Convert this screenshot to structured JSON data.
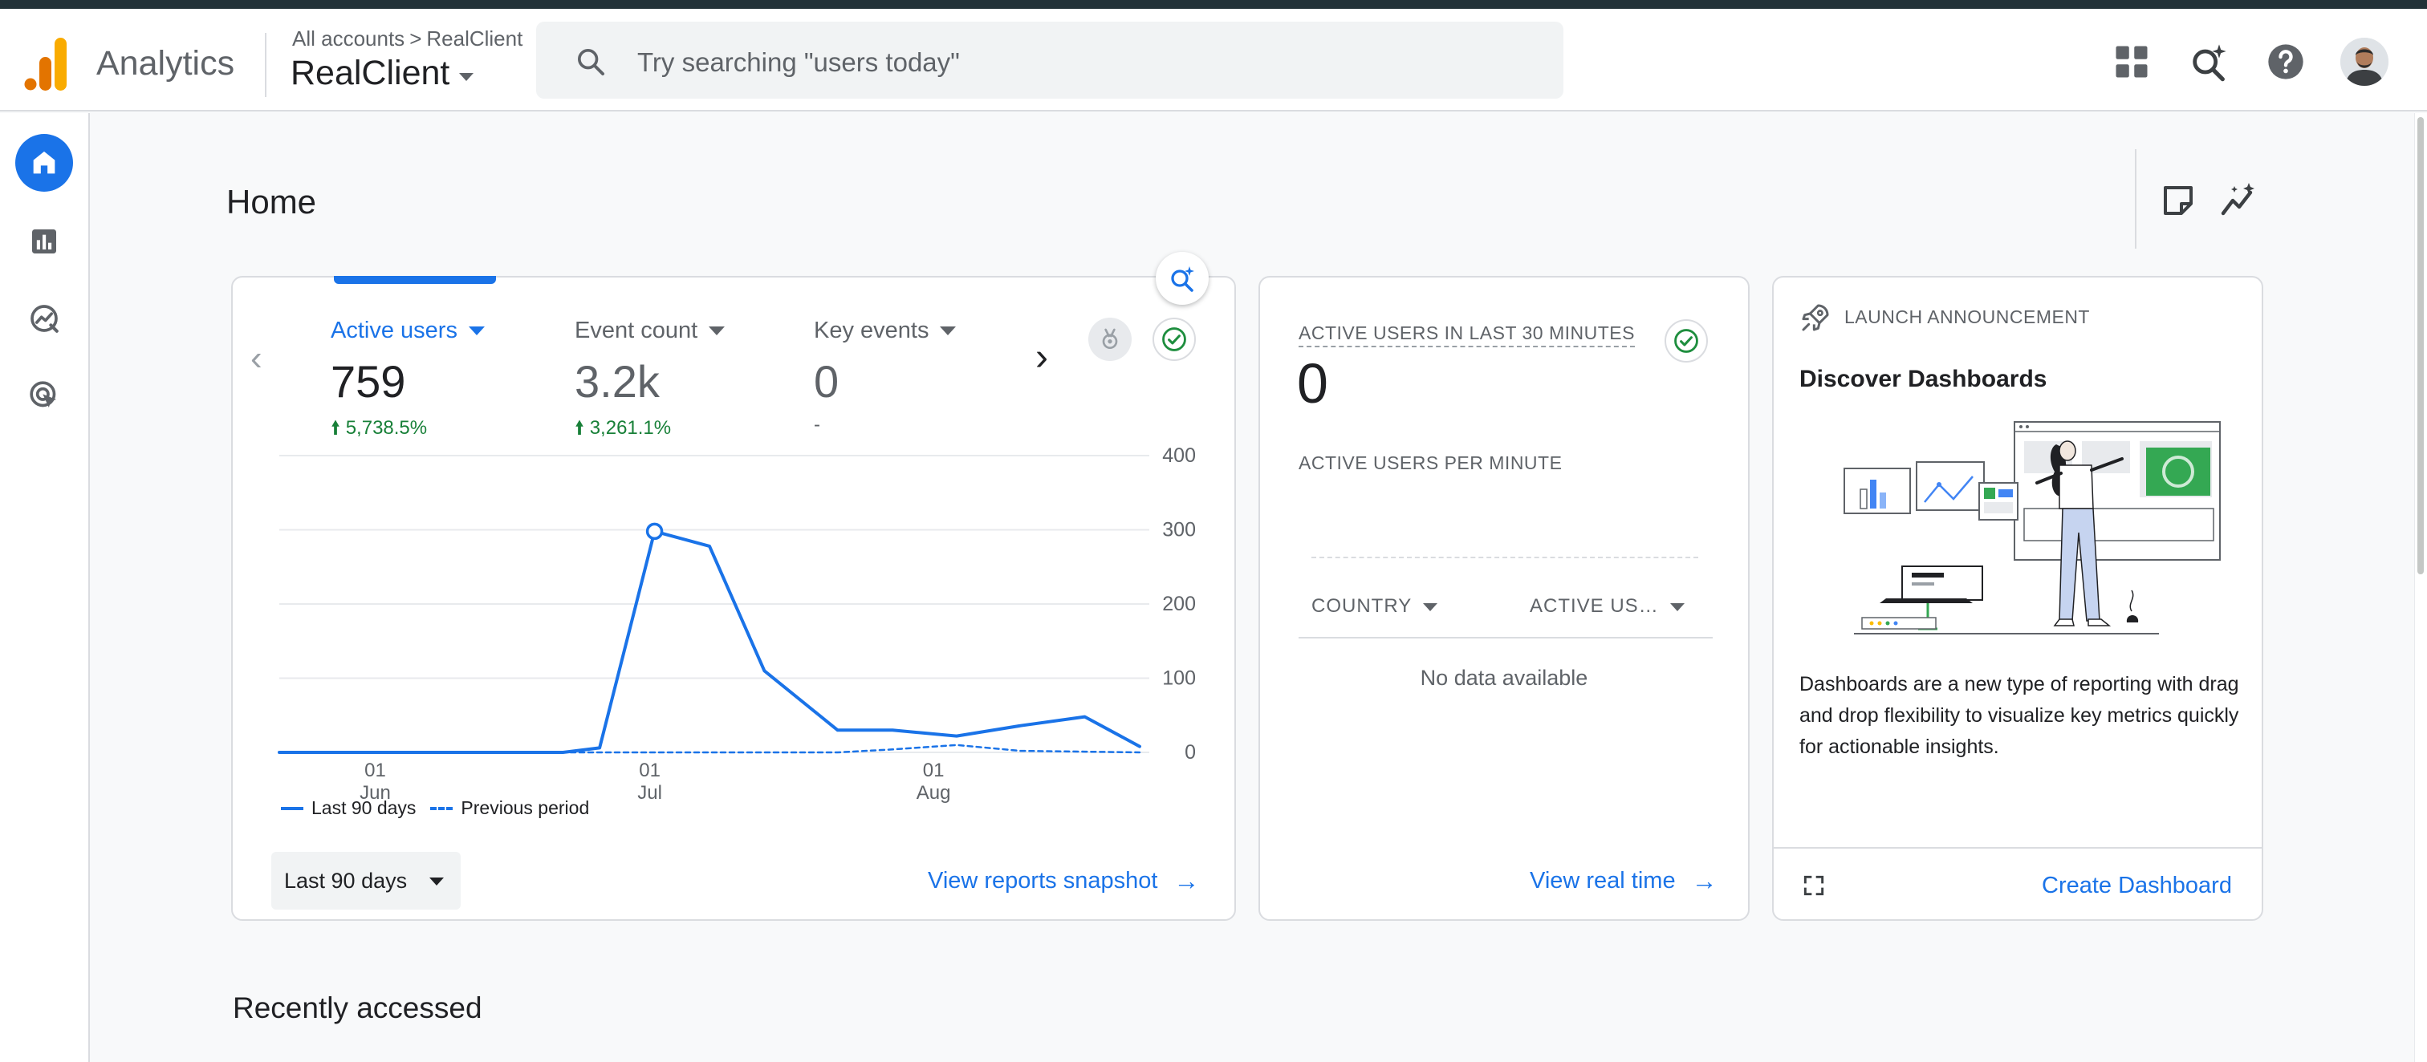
{
  "header": {
    "app_name": "Analytics",
    "breadcrumb_root": "All accounts",
    "breadcrumb_sep": ">",
    "breadcrumb_account": "RealClient",
    "account_name": "RealClient",
    "search_placeholder": "Try searching \"users today\"",
    "icons": [
      "apps-grid-icon",
      "search-insights-icon",
      "help-icon",
      "account-avatar"
    ]
  },
  "sidenav": {
    "items": [
      {
        "name": "home",
        "icon": "home-icon",
        "active": true
      },
      {
        "name": "reports",
        "icon": "bar-chart-icon",
        "active": false
      },
      {
        "name": "explore",
        "icon": "explore-trend-icon",
        "active": false
      },
      {
        "name": "advertising",
        "icon": "ad-target-icon",
        "active": false
      }
    ]
  },
  "page": {
    "title": "Home",
    "toolbar_icons": [
      "notes-icon",
      "insights-icon"
    ]
  },
  "overview_card": {
    "metrics": [
      {
        "label": "Active users",
        "value": "759",
        "change": "5,738.5%",
        "direction": "up",
        "selected": true
      },
      {
        "label": "Event count",
        "value": "3.2k",
        "change": "3,261.1%",
        "direction": "up",
        "selected": false
      },
      {
        "label": "Key events",
        "value": "0",
        "change": "-",
        "direction": "none",
        "selected": false
      }
    ],
    "legend": {
      "current": "Last 90 days",
      "previous": "Previous period"
    },
    "date_range": "Last 90 days",
    "cta": "View reports snapshot"
  },
  "chart_data": {
    "type": "line",
    "x_ticks": [
      {
        "day": "01",
        "month": "Jun"
      },
      {
        "day": "01",
        "month": "Jul"
      },
      {
        "day": "01",
        "month": "Aug"
      }
    ],
    "ylim": [
      0,
      400
    ],
    "y_ticks": [
      "400",
      "300",
      "200",
      "100",
      "0"
    ],
    "grid": true,
    "series": [
      {
        "name": "Last 90 days",
        "style": "solid",
        "color": "#1a73e8",
        "x": [
          "May 21",
          "Jun 1",
          "Jun 15",
          "Jun 21",
          "Jun 25",
          "Jul 1",
          "Jul 7",
          "Jul 13",
          "Jul 21",
          "Jul 27",
          "Aug 3",
          "Aug 10",
          "Aug 17",
          "Aug 23"
        ],
        "values": [
          0,
          0,
          0,
          0,
          6,
          298,
          278,
          110,
          30,
          30,
          22,
          36,
          48,
          8
        ]
      },
      {
        "name": "Previous period",
        "style": "dashed",
        "color": "#1a73e8",
        "x": [
          "May 21",
          "Jun 1",
          "Jun 15",
          "Jun 21",
          "Jun 25",
          "Jul 1",
          "Jul 7",
          "Jul 13",
          "Jul 21",
          "Jul 27",
          "Aug 3",
          "Aug 10",
          "Aug 17",
          "Aug 23"
        ],
        "values": [
          0,
          0,
          0,
          0,
          0,
          0,
          0,
          0,
          0,
          4,
          10,
          2,
          1,
          0
        ]
      }
    ],
    "highlight_point": {
      "x": "Jul 1",
      "value": 298
    }
  },
  "realtime_card": {
    "title": "ACTIVE USERS IN LAST 30 MINUTES",
    "value": "0",
    "subtitle": "ACTIVE USERS PER MINUTE",
    "col_country": "COUNTRY",
    "col_active": "ACTIVE US…",
    "empty": "No data available",
    "cta": "View real time"
  },
  "announcement_card": {
    "tag": "LAUNCH ANNOUNCEMENT",
    "title": "Discover Dashboards",
    "description": "Dashboards are a new type of reporting with drag and drop flexibility to visualize key metrics quickly for actionable insights.",
    "cta": "Create Dashboard"
  },
  "recent": {
    "title": "Recently accessed"
  },
  "colors": {
    "accent": "#1a73e8",
    "positive": "#188038",
    "check": "#1e8e3e",
    "logo_orange": "#f9ab00",
    "logo_dark_orange": "#e37400"
  }
}
